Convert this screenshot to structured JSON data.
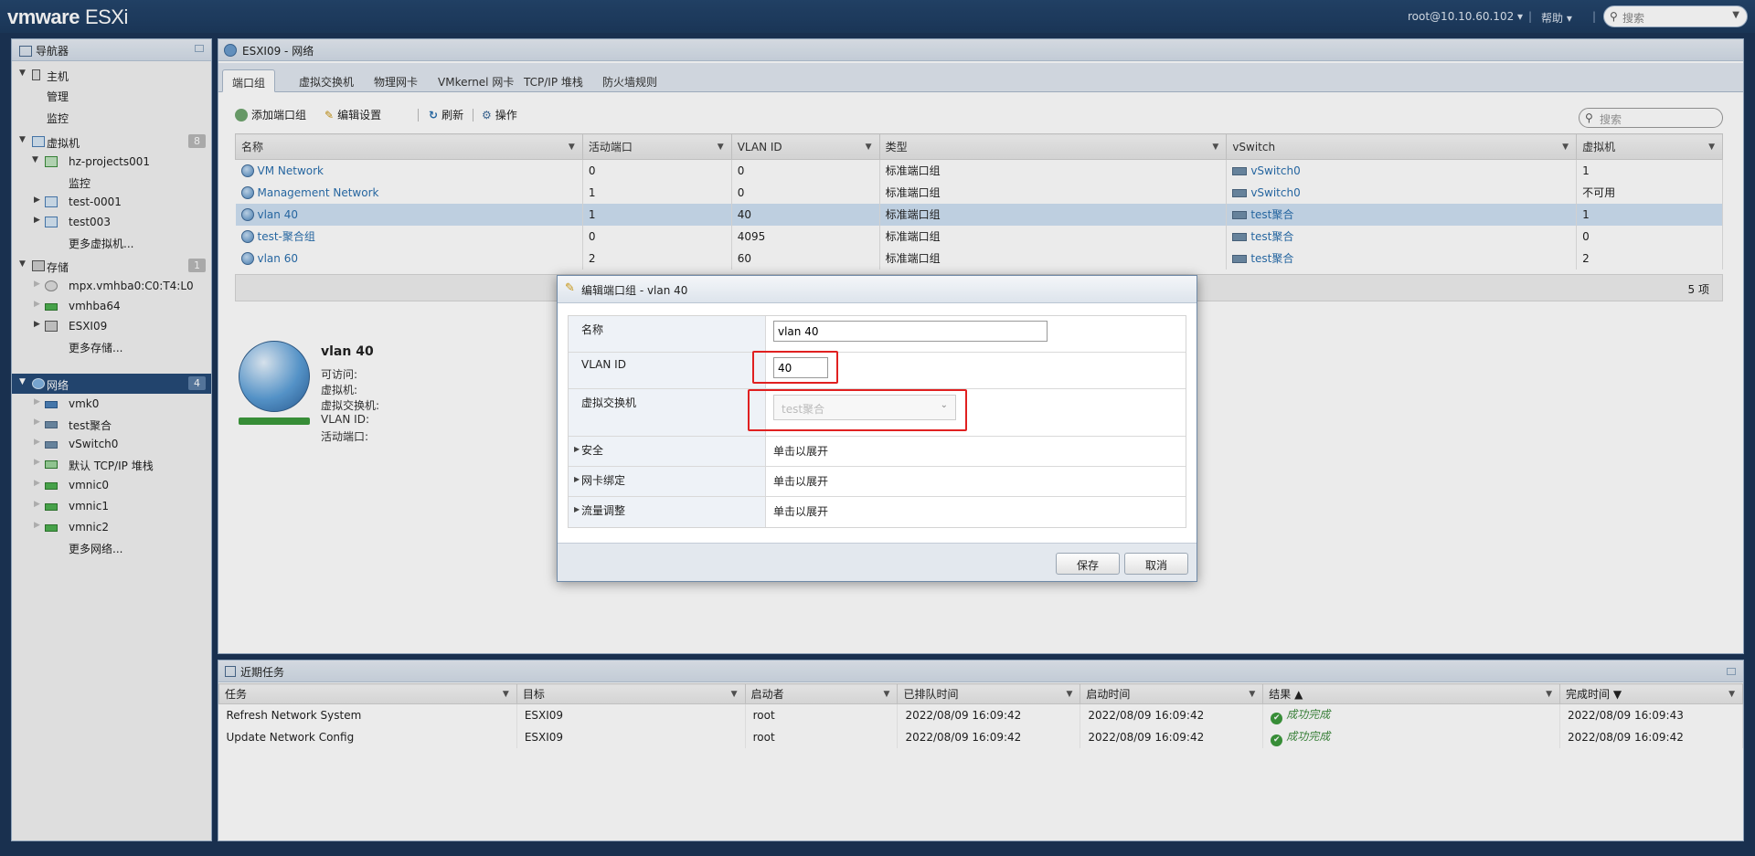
{
  "topbar": {
    "brand": "vmware",
    "product": "ESXi",
    "user": "root@10.10.60.102",
    "help": "帮助",
    "search_placeholder": "搜索"
  },
  "navigator": {
    "title": "导航器",
    "items": [
      {
        "label": "主机"
      },
      {
        "label": "管理"
      },
      {
        "label": "监控"
      },
      {
        "label": "虚拟机",
        "count": "8"
      },
      {
        "label": "hz-projects001"
      },
      {
        "label": "监控"
      },
      {
        "label": "test-0001"
      },
      {
        "label": "test003"
      },
      {
        "label": "更多虚拟机..."
      },
      {
        "label": "存储",
        "count": "1"
      },
      {
        "label": "mpx.vmhba0:C0:T4:L0"
      },
      {
        "label": "vmhba64"
      },
      {
        "label": "ESXI09"
      },
      {
        "label": "更多存储..."
      },
      {
        "label": "网络",
        "count": "4"
      },
      {
        "label": "vmk0"
      },
      {
        "label": "test聚合"
      },
      {
        "label": "vSwitch0"
      },
      {
        "label": "默认 TCP/IP 堆栈"
      },
      {
        "label": "vmnic0"
      },
      {
        "label": "vmnic1"
      },
      {
        "label": "vmnic2"
      },
      {
        "label": "更多网络..."
      }
    ]
  },
  "main": {
    "title": "ESXI09 - 网络",
    "tabs": [
      "端口组",
      "虚拟交换机",
      "物理网卡",
      "VMkernel 网卡",
      "TCP/IP 堆栈",
      "防火墙规则"
    ],
    "toolbar": {
      "add": "添加端口组",
      "edit": "编辑设置",
      "refresh": "刷新",
      "actions": "操作",
      "search_placeholder": "搜索"
    },
    "columns": [
      "名称",
      "活动端口",
      "VLAN ID",
      "类型",
      "vSwitch",
      "虚拟机"
    ],
    "rows": [
      {
        "name": "VM Network",
        "ports": "0",
        "vlan": "0",
        "type": "标准端口组",
        "vswitch": "vSwitch0",
        "vms": "1"
      },
      {
        "name": "Management Network",
        "ports": "1",
        "vlan": "0",
        "type": "标准端口组",
        "vswitch": "vSwitch0",
        "vms": "不可用"
      },
      {
        "name": "vlan 40",
        "ports": "1",
        "vlan": "40",
        "type": "标准端口组",
        "vswitch": "test聚合",
        "vms": "1"
      },
      {
        "name": "test-聚合组",
        "ports": "0",
        "vlan": "4095",
        "type": "标准端口组",
        "vswitch": "test聚合",
        "vms": "0"
      },
      {
        "name": "vlan 60",
        "ports": "2",
        "vlan": "60",
        "type": "标准端口组",
        "vswitch": "test聚合",
        "vms": "2"
      }
    ],
    "item_count": "5 项",
    "detail": {
      "title": "vlan 40",
      "fields": [
        "可访问:",
        "虚拟机:",
        "虚拟交换机:",
        "VLAN ID:",
        "活动端口:"
      ]
    }
  },
  "tasks": {
    "title": "近期任务",
    "columns": [
      "任务",
      "目标",
      "启动者",
      "已排队时间",
      "启动时间",
      "结果 ▲",
      "完成时间 ▼"
    ],
    "rows": [
      {
        "task": "Refresh Network System",
        "target": "ESXI09",
        "initiator": "root",
        "queued": "2022/08/09 16:09:42",
        "started": "2022/08/09 16:09:42",
        "result": "成功完成",
        "completed": "2022/08/09 16:09:43"
      },
      {
        "task": "Update Network Config",
        "target": "ESXI09",
        "initiator": "root",
        "queued": "2022/08/09 16:09:42",
        "started": "2022/08/09 16:09:42",
        "result": "成功完成",
        "completed": "2022/08/09 16:09:42"
      }
    ]
  },
  "dialog": {
    "title": "编辑端口组 - vlan 40",
    "name_label": "名称",
    "name_value": "vlan 40",
    "vlan_label": "VLAN ID",
    "vlan_value": "40",
    "vswitch_label": "虚拟交换机",
    "vswitch_value": "test聚合",
    "security_label": "安全",
    "security_value": "单击以展开",
    "nic_label": "网卡绑定",
    "nic_value": "单击以展开",
    "traffic_label": "流量调整",
    "traffic_value": "单击以展开",
    "save": "保存",
    "cancel": "取消"
  }
}
